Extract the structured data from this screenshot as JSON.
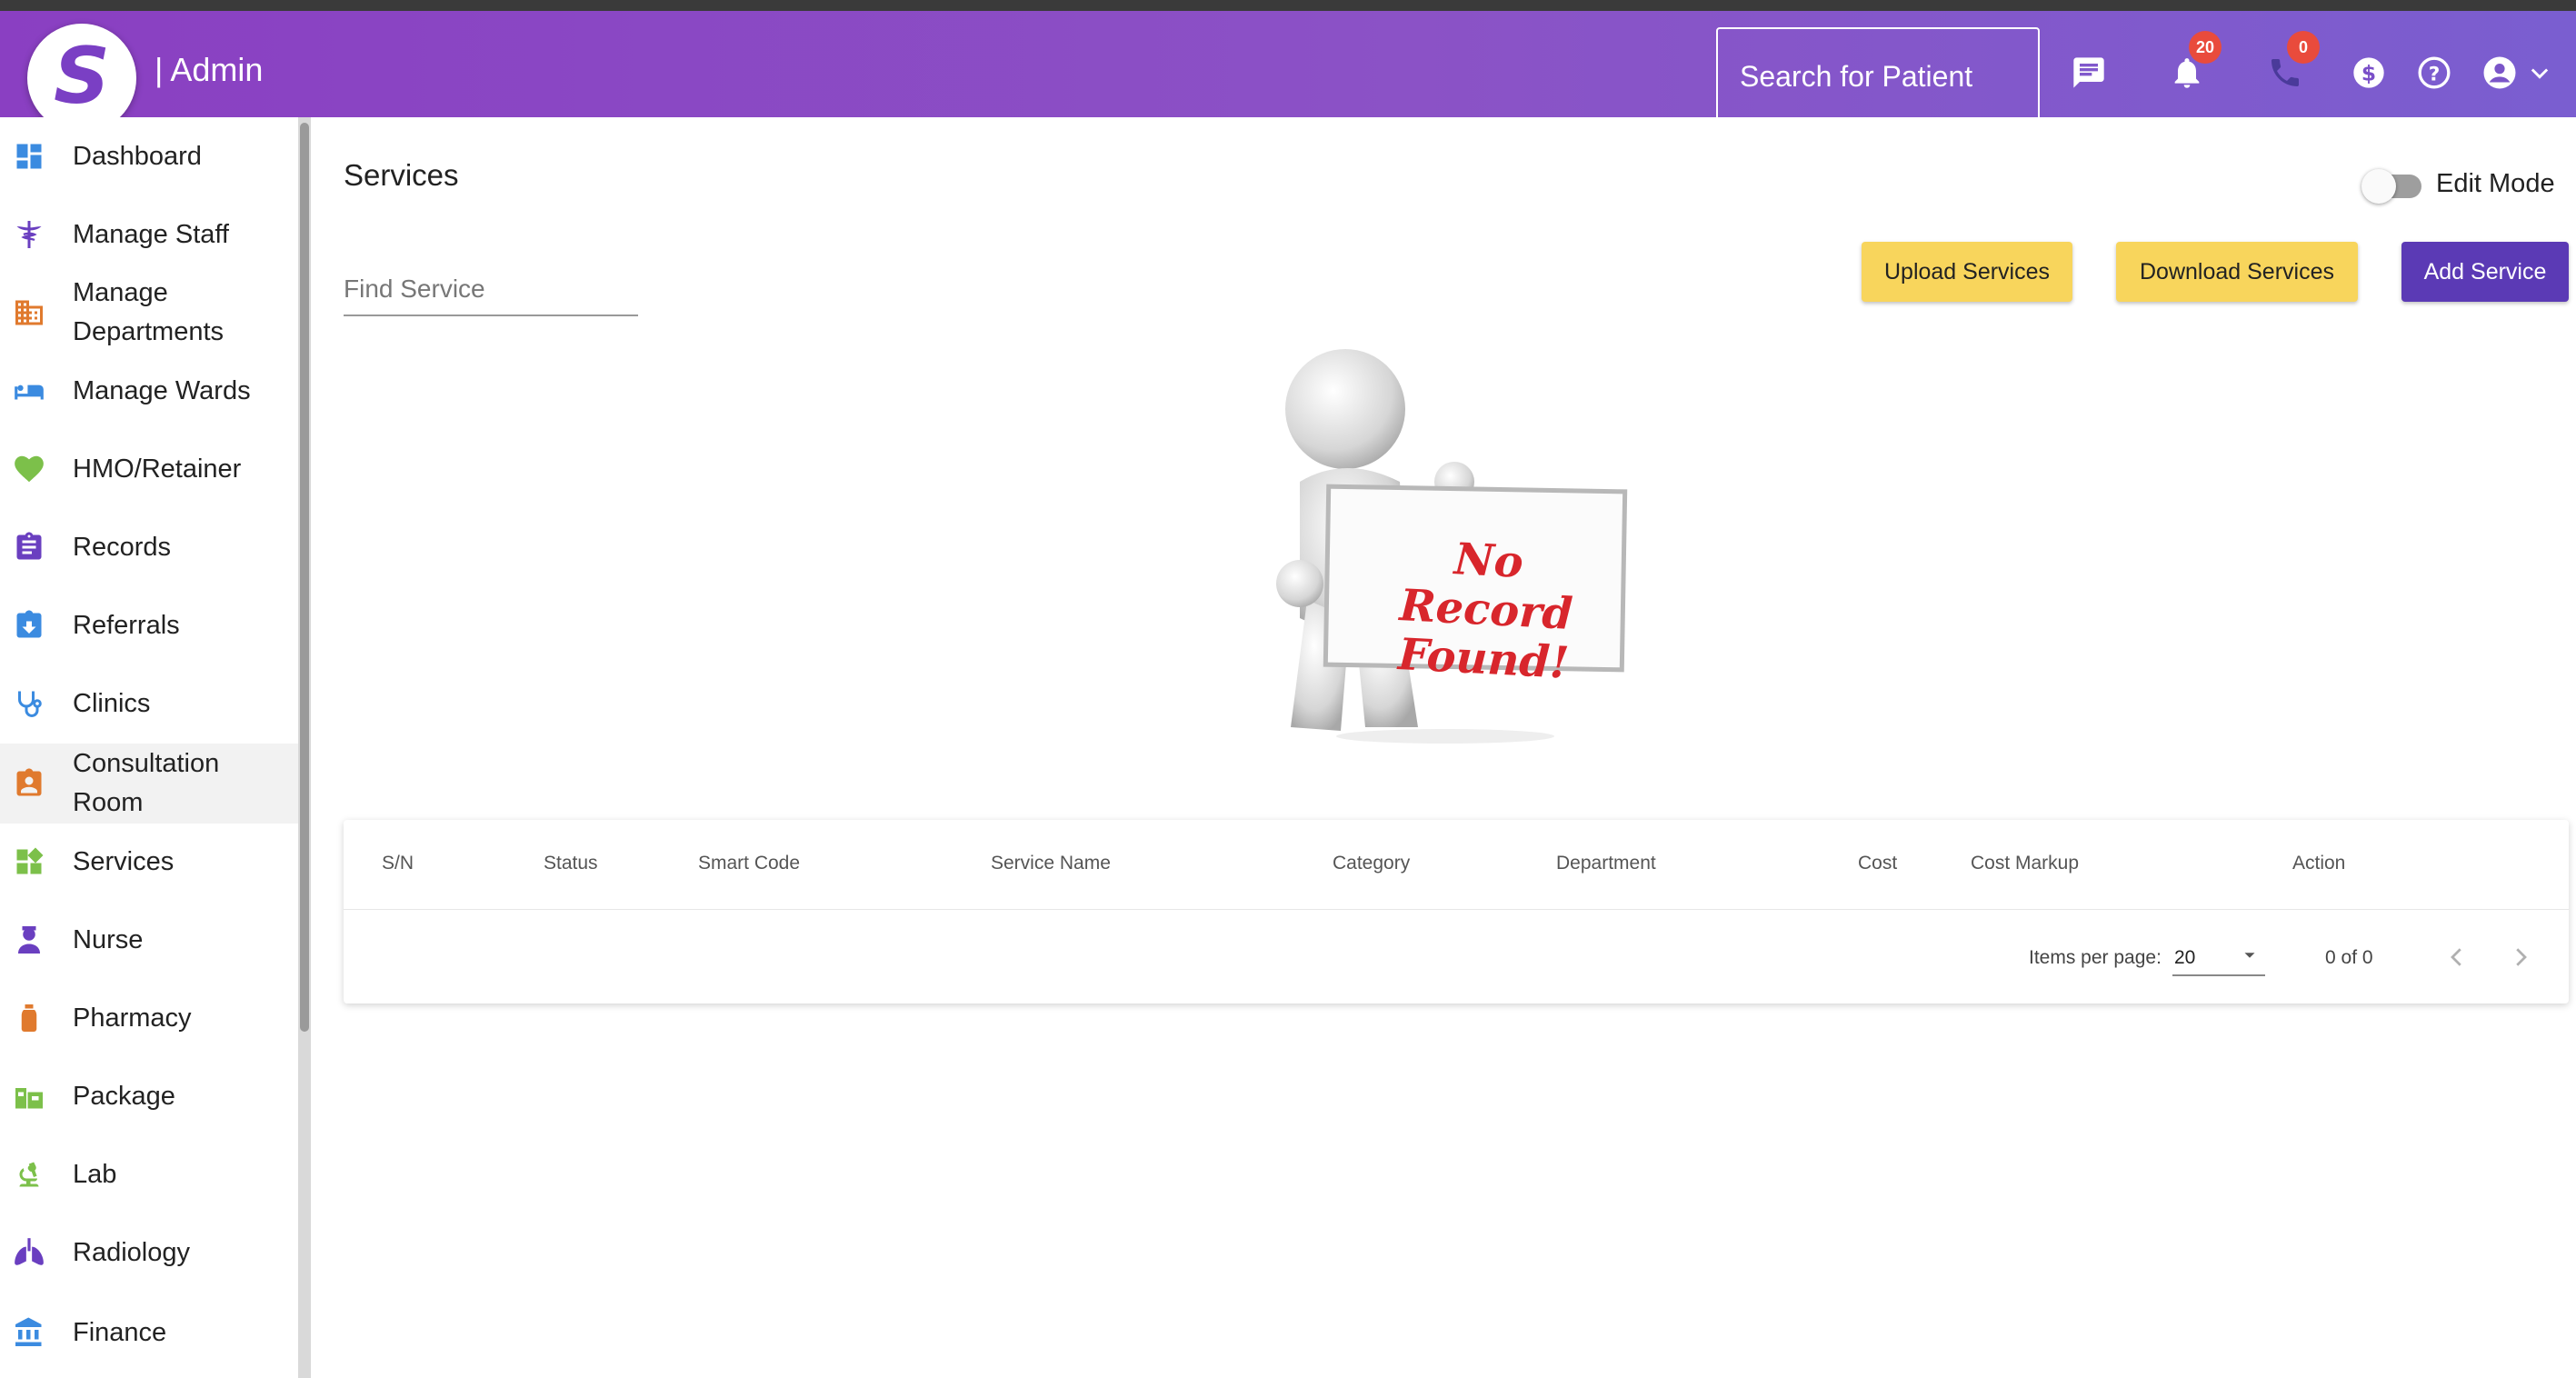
{
  "header": {
    "brand_letter": "S",
    "brand_title": "| Admin",
    "search_label": "Search for Patient",
    "notifications_count": "20",
    "calls_count": "0"
  },
  "sidebar": {
    "items": [
      {
        "label": "Dashboard",
        "icon": "dashboard-icon",
        "color": "#3b8be0"
      },
      {
        "label": "Manage Staff",
        "icon": "caduceus-icon",
        "color": "#6a3fc0"
      },
      {
        "label": "Manage Departments",
        "icon": "building-icon",
        "color": "#e07a2e"
      },
      {
        "label": "Manage Wards",
        "icon": "bed-icon",
        "color": "#3b8be0"
      },
      {
        "label": "HMO/Retainer",
        "icon": "hand-heart-icon",
        "color": "#7cc04a"
      },
      {
        "label": "Records",
        "icon": "clipboard-icon",
        "color": "#6a3fc0"
      },
      {
        "label": "Referrals",
        "icon": "referral-icon",
        "color": "#3b8be0"
      },
      {
        "label": "Clinics",
        "icon": "stethoscope-icon",
        "color": "#3b8be0"
      },
      {
        "label": "Consultation Room",
        "icon": "contact-card-icon",
        "color": "#e07a2e"
      },
      {
        "label": "Services",
        "icon": "services-icon",
        "color": "#7cc04a"
      },
      {
        "label": "Nurse",
        "icon": "nurse-icon",
        "color": "#6a3fc0"
      },
      {
        "label": "Pharmacy",
        "icon": "bottle-icon",
        "color": "#e07a2e"
      },
      {
        "label": "Package",
        "icon": "package-icon",
        "color": "#7cc04a"
      },
      {
        "label": "Lab",
        "icon": "microscope-icon",
        "color": "#7cc04a"
      },
      {
        "label": "Radiology",
        "icon": "lungs-icon",
        "color": "#6a3fc0"
      },
      {
        "label": "Finance",
        "icon": "bank-icon",
        "color": "#3b8be0"
      }
    ]
  },
  "main": {
    "title": "Services",
    "edit_mode_label": "Edit Mode",
    "edit_mode_on": false,
    "find_placeholder": "Find Service",
    "buttons": {
      "upload": "Upload Services",
      "download": "Download Services",
      "add": "Add Service"
    },
    "empty_state_line1": "No Record",
    "empty_state_line2": "Found!"
  },
  "table": {
    "columns": [
      "S/N",
      "Status",
      "Smart Code",
      "Service Name",
      "Category",
      "Department",
      "Cost",
      "Cost Markup",
      "Action"
    ],
    "rows": []
  },
  "pagination": {
    "items_per_page_label": "Items per page:",
    "items_per_page": "20",
    "range": "0 of 0"
  },
  "colors": {
    "header_gradient_start": "#8a3fc2",
    "header_gradient_end": "#7a5ed0",
    "primary_button": "#5b3ab5",
    "secondary_button": "#f8d55c",
    "badge": "#e94b3c"
  }
}
